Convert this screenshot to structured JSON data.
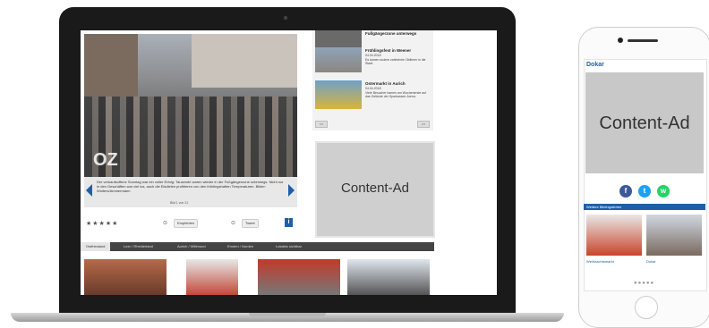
{
  "laptop": {
    "photo_watermark": "OZ",
    "gallery_caption": "Der verkaufsoffene Sonntag war ein voller Erfolg: Tausende waren wieder in der Fußgängerzone unterwegs. Nicht nur in den Geschäften war viel los, auch die Eisdielen profitieren von den frühlingshaften Temperaturen. Bilder: Wolters/Ammermann",
    "gallery_count": "Bild 1 von 21",
    "rating_stars": "★★★★★",
    "recommend_label": "Empfehlen",
    "tweet_label": "Tweet",
    "info_label": "i",
    "tabs": [
      "Ostfriesland",
      "Leer / Rheiderland",
      "Aurich / Wittmund",
      "Emden / Norden",
      "Lokales sichtbar"
    ],
    "news": [
      {
        "title": "Fußgängerzone unterwegs",
        "date": "",
        "desc": ""
      },
      {
        "title": "Frühlingsfest in Weener",
        "date": "04.04.2018",
        "desc": "Es kamen zudem zahlreiche Oldtimer in die Stadt."
      },
      {
        "title": "Ostermarkt in Aurich",
        "date": "04.04.2018",
        "desc": "Viele Besucher kamen am Wochenende auf das Gelände der Sparkassen-Arena."
      }
    ],
    "news_prev": "<<",
    "news_next": ">>",
    "content_ad": "Content-Ad"
  },
  "phone": {
    "title": "Dokar",
    "content_ad": "Content-Ad",
    "section_bar": "Weitere Bildergalerien",
    "thumb_captions": [
      "Weihnachtsmarkt",
      "Dokar"
    ],
    "share_icons": [
      "facebook-icon",
      "twitter-icon",
      "whatsapp-icon"
    ],
    "pager_dots": "●●●●●"
  },
  "colors": {
    "accent": "#1e5fa8",
    "ad_gray": "#cfcfcf",
    "facebook": "#3b5998",
    "twitter": "#1da1f2",
    "whatsapp": "#25d366"
  }
}
